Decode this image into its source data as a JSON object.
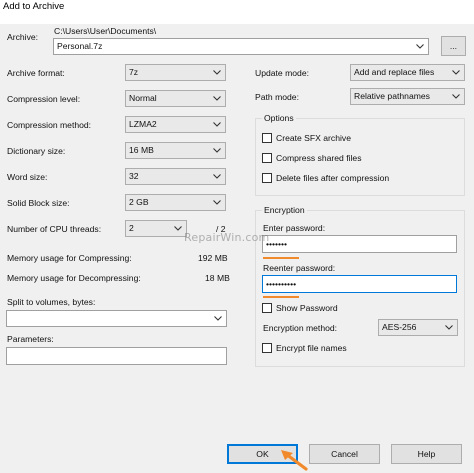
{
  "window": {
    "title": "Add to Archive"
  },
  "archive": {
    "label": "Archive:",
    "path": "C:\\Users\\User\\Documents\\",
    "filename": "Personal.7z",
    "browse_label": "..."
  },
  "left": {
    "archive_format": {
      "label": "Archive format:",
      "value": "7z"
    },
    "compression_level": {
      "label": "Compression level:",
      "value": "Normal"
    },
    "compression_method": {
      "label": "Compression method:",
      "value": "LZMA2"
    },
    "dictionary_size": {
      "label": "Dictionary size:",
      "value": "16 MB"
    },
    "word_size": {
      "label": "Word size:",
      "value": "32"
    },
    "solid_block_size": {
      "label": "Solid Block size:",
      "value": "2 GB"
    },
    "cpu_threads": {
      "label": "Number of CPU threads:",
      "value": "2",
      "max": "/ 2"
    },
    "memory_compressing": {
      "label": "Memory usage for Compressing:",
      "value": "192 MB"
    },
    "memory_decompressing": {
      "label": "Memory usage for Decompressing:",
      "value": "18 MB"
    },
    "split_volumes": {
      "label": "Split to volumes, bytes:",
      "value": ""
    },
    "parameters": {
      "label": "Parameters:",
      "value": ""
    }
  },
  "right": {
    "update_mode": {
      "label": "Update mode:",
      "value": "Add and replace files"
    },
    "path_mode": {
      "label": "Path mode:",
      "value": "Relative pathnames"
    },
    "options": {
      "title": "Options",
      "create_sfx": "Create SFX archive",
      "compress_shared": "Compress shared files",
      "delete_after": "Delete files after compression"
    },
    "encryption": {
      "title": "Encryption",
      "enter_password_label": "Enter password:",
      "enter_password_value": "•••••••",
      "reenter_password_label": "Reenter password:",
      "reenter_password_value": "••••••••••",
      "show_password": "Show Password",
      "method_label": "Encryption method:",
      "method_value": "AES-256",
      "encrypt_names": "Encrypt file names"
    }
  },
  "buttons": {
    "ok": "OK",
    "cancel": "Cancel",
    "help": "Help"
  },
  "watermark": "RepairWin.com",
  "colors": {
    "accent": "#0078d7",
    "annotation": "#f08a2c"
  }
}
